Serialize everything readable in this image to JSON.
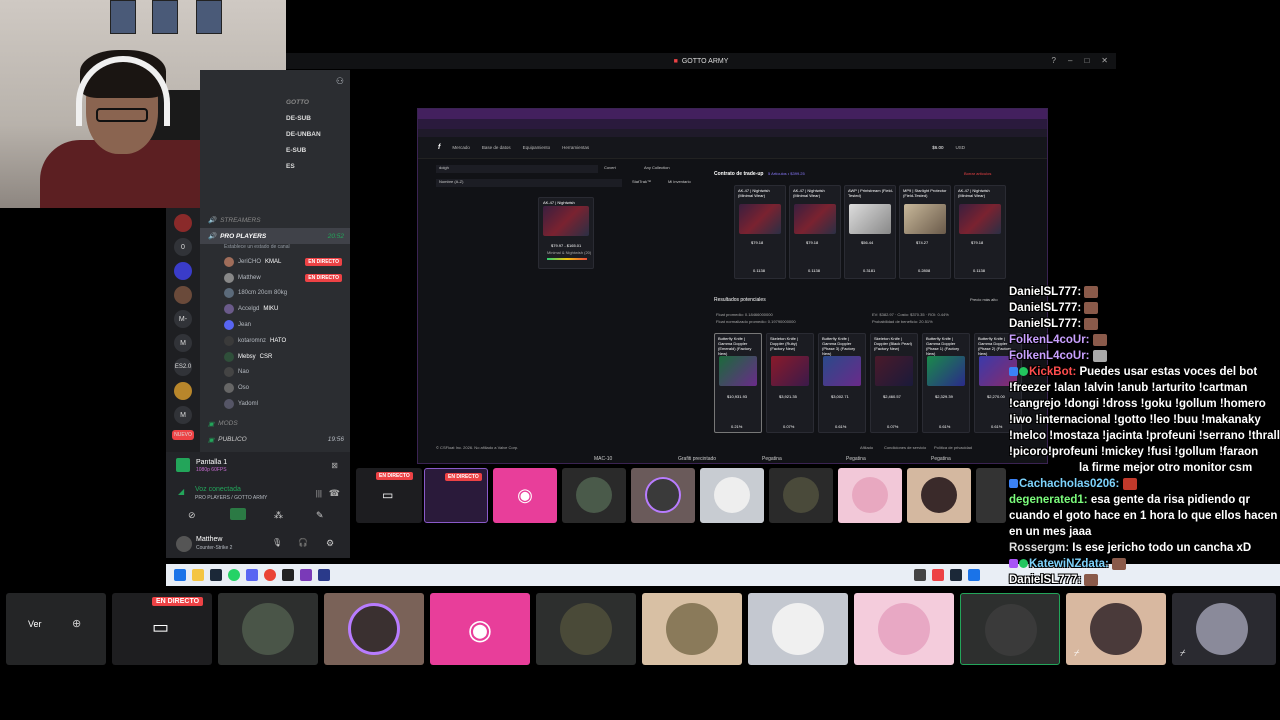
{
  "window": {
    "title": "GOTTO ARMY"
  },
  "discord": {
    "server_list": [
      "0",
      "M-",
      "M",
      "ES2.0",
      "M",
      "NUEVO"
    ],
    "channels_top": [
      "GOTTO",
      "DE-SUB",
      "DE-UNBAN",
      "E-SUB",
      "ES"
    ],
    "category_streamers": "STREAMERS",
    "voice_channel": {
      "name": "PRO PLAYERS",
      "time": "20:52",
      "status": "Establece un estado de canal"
    },
    "voice_users": [
      {
        "name": "JeriCHO",
        "tag": "KMAL",
        "live": true
      },
      {
        "name": "Matthew",
        "tag": "",
        "live": true
      },
      {
        "name": "180cm 20cm 80kg",
        "tag": "",
        "live": false
      },
      {
        "name": "Accelgd",
        "tag": "MIKU",
        "live": false
      },
      {
        "name": "Jean",
        "tag": "",
        "live": false
      },
      {
        "name": "kotaromnz",
        "tag": "HATO",
        "live": false
      },
      {
        "name": "Mebsy",
        "tag": "CSR",
        "live": false
      },
      {
        "name": "Nao",
        "tag": "",
        "live": false
      },
      {
        "name": "Oso",
        "tag": "",
        "live": false
      },
      {
        "name": "Yadoml",
        "tag": "",
        "live": false
      }
    ],
    "live_label": "EN DIRECTO",
    "category_mods": "MODS",
    "category_publico": "PUBLICO",
    "publico_time": "19:56",
    "screen_share": {
      "title": "Pantalla 1",
      "sub": "1080p 60FPS"
    },
    "voice_connected": {
      "title": "Voz conectada",
      "sub": "PRO PLAYERS / GOTTO ARMY"
    },
    "user": {
      "name": "Matthew",
      "activity": "Counter-Strike 2"
    }
  },
  "browser": {
    "nav": [
      "Mercado",
      "Base de datos",
      "Equipamiento",
      "Herramientas"
    ],
    "balance": "$6.00",
    "currency": "USD",
    "search_value": "doigh",
    "filter_covert": "Covert",
    "filter_collection": "Any Collection",
    "sort": "Nombre (A-Z)",
    "toggle1": "StatTrak™",
    "toggle2": "Mi inventario",
    "selected_skin": {
      "name": "AK-47 | Nightwish",
      "price": "$79.97 - $165.01",
      "wear": "Minimal & Nightwish (20)"
    },
    "contract_title": "Contrato de trade-up",
    "contract_count": "5 Artículos • $399.25",
    "contract_clear": "Borrar artículos",
    "contract_items": [
      {
        "name": "AK-47 | Nightwish (Minimal Wear)",
        "price": "$79.18",
        "float": "0.1138"
      },
      {
        "name": "AK-47 | Nightwish (Minimal Wear)",
        "price": "$79.18",
        "float": "0.1138"
      },
      {
        "name": "AWP | Printstream (Field-Tested)",
        "price": "$56.44",
        "float": "0.3181"
      },
      {
        "name": "MP9 | Starlight Protector (Field-Tested)",
        "price": "$74.27",
        "float": "0.2808"
      },
      {
        "name": "AK-47 | Nightwish (Minimal Wear)",
        "price": "$79.18",
        "float": "0.1138"
      }
    ],
    "results_title": "Resultados potenciales",
    "results_sort": "Precio más alto",
    "float_avg": "Float promedio: 0.18466000000",
    "float_norm": "Float normalizado promedio: 0.19790000000",
    "ev": "EV: $382.97 · Costo: $370.35 · ROI: 0.44%",
    "profit_prob": "Probabilidad de beneficio: 20.51%",
    "results": [
      {
        "name": "Butterfly Knife | Gamma Doppler (Emerald) (Factory New)",
        "price": "$10,931.93",
        "pct": "0.21%"
      },
      {
        "name": "Skeleton Knife | Doppler (Ruby) (Factory New)",
        "price": "$3,921.35",
        "pct": "0.07%"
      },
      {
        "name": "Butterfly Knife | Gamma Doppler (Phase 3) (Factory New)",
        "price": "$3,002.71",
        "pct": "0.61%"
      },
      {
        "name": "Skeleton Knife | Doppler (Black Pearl) (Factory New)",
        "price": "$2,460.57",
        "pct": "0.07%"
      },
      {
        "name": "Butterfly Knife | Gamma Doppler (Phase 1) (Factory New)",
        "price": "$2,329.39",
        "pct": "0.61%"
      },
      {
        "name": "Butterfly Knife | Gamma Doppler (Phase 2) (Factory New)",
        "price": "$2,270.00",
        "pct": "0.61%"
      }
    ],
    "footer": "© CSFloat Inc. 2026. No afiliado a Valve Corp.",
    "footer_links": [
      "Afiliado",
      "Condiciones de servicio",
      "Política de privacidad"
    ]
  },
  "taskbar_labels": [
    "MAC-10",
    "Grafiti precintado",
    "Pegatina",
    "Pegatina",
    "Pegatina"
  ],
  "stream_labels": {
    "live": "EN DIRECTO",
    "ver": "Ver"
  },
  "chat": [
    {
      "user": "DanielSL777:",
      "text": ""
    },
    {
      "user": "DanielSL777:",
      "text": ""
    },
    {
      "user": "DanielSL777:",
      "text": ""
    },
    {
      "user": "FolkenL4coUr:",
      "text": ""
    },
    {
      "user": "FolkenL4coUr:",
      "text": ""
    },
    {
      "user": "KickBot:",
      "text": "Puedes usar estas voces del bot !freezer !alan !alvin !anub !arturito !cartman !cangrejo !dongi !dross !goku !gollum !homero !iwo !internacional !gotto !leo !buu !makanaky !melco !mostaza !jacinta !profeuni !serrano !thrall !picoro!profeuni !mickey !fusi !gollum !faraon"
    },
    {
      "user": "",
      "text": "la firme mejor otro monitor csm"
    },
    {
      "user": "Cachacholas0206:",
      "text": ""
    },
    {
      "user": "degenerated1:",
      "text": "esa gente da risa pidiendo qr cuando el goto hace en 1 hora lo que ellos hacen en un mes jaaa"
    },
    {
      "user": "Rossergm:",
      "text": "Is ese jericho todo un cancha xD"
    },
    {
      "user": "KatewiNZdata:",
      "text": ""
    },
    {
      "user": "DanielSL777:",
      "text": ""
    }
  ],
  "colors": {
    "discord_pink": "#e83e9a",
    "live_red": "#ed4245",
    "kickbot_red": "#ff4d4d",
    "chat_green": "#7CFC7C"
  }
}
